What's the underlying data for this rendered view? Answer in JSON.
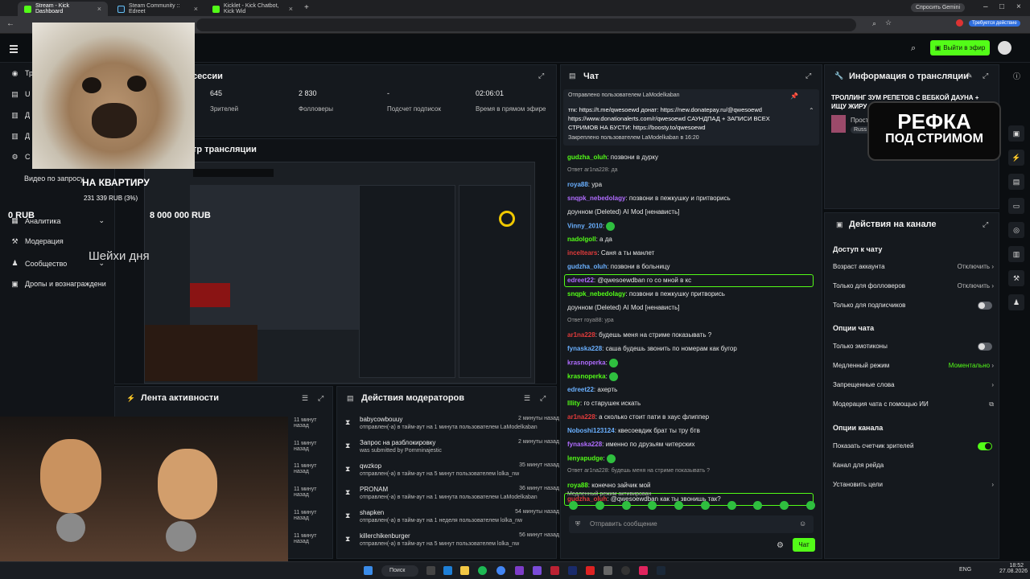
{
  "browser": {
    "tabs": [
      "Stream - Kick Dashboard",
      "Steam Community :: Edreet",
      "Kicklet - Kick Chatbot, Kick Wid"
    ],
    "gemini_label": "Спросить Gemini",
    "action_required": "Требуется действие"
  },
  "header": {
    "go_live": "Выйти в эфир"
  },
  "sidebar": {
    "items": [
      "Тр",
      "U",
      "Д",
      "Д",
      "С",
      "Аналитика",
      "Модерация",
      "Сообщество",
      "Дропы и вознаграждени"
    ],
    "video_label": "Видео по запросу"
  },
  "overlay": {
    "goal_title": "НА КВАРТИРУ",
    "goal_progress": "231 339 RUB (3%)",
    "goal_current": "0 RUB",
    "goal_target": "8 000 000 RUB",
    "pug_caption": "Шейхи дня",
    "refka_line1": "РЕФКА",
    "refka_line2": "ПОД СТРИМОМ"
  },
  "session": {
    "title": "сессии",
    "stats": [
      {
        "value": "645",
        "label": "Зрителей"
      },
      {
        "value": "2 830",
        "label": "Фолловеры"
      },
      {
        "value": "-",
        "label": "Подсчет подписок"
      },
      {
        "value": "02:06:01",
        "label": "Время в прямом эфире"
      }
    ]
  },
  "preview": {
    "title": "тр трансляции"
  },
  "activity": {
    "title": "Лента активности",
    "times": [
      "11 минут назад",
      "11 минут назад",
      "11 минут назад",
      "11 минут назад",
      "11 минут назад",
      "11 минут назад"
    ]
  },
  "modlog": {
    "title": "Действия модераторов",
    "rows": [
      {
        "name": "babycowbouuy",
        "desc": "отправлен(-а) в тайм-аут на 1 минута пользователем LaModelkaban",
        "time": "2 минуты назад"
      },
      {
        "name": "Запрос на разблокировку",
        "desc": "was submitted by Pornminajestic",
        "time": "2 минуты назад"
      },
      {
        "name": "qwzkop",
        "desc": "отправлен(-а) в тайм-аут на 5 минут пользователем lolka_nw",
        "time": "35 минут назад"
      },
      {
        "name": "PRONAM",
        "desc": "отправлен(-а) в тайм-аут на 1 минута пользователем LaModelkaban",
        "time": "36 минут назад"
      },
      {
        "name": "shapken",
        "desc": "отправлен(-а) в тайм-аут на 1 неделя пользователем lolka_nw",
        "time": "54 минуты назад"
      },
      {
        "name": "killerchikenburger",
        "desc": "отправлен(-а) в тайм-аут на 5 минут пользователем lolka_nw",
        "time": "56 минут назад"
      }
    ]
  },
  "chat": {
    "title": "Чат",
    "pinned_by": "Отправлено пользователем LaModelkaban",
    "pinned_lines": [
      "тгк: https://t.me/qwesoewd донат: https://new.donatepay.ru/@qwesoewd",
      "https://www.donationalerts.com/r/qwesoewd САУНДПАД + ЗАПИСИ ВСЕХ",
      "СТРИМОВ НА БУСТИ: https://boosty.to/qwesoewd"
    ],
    "pinned_footer": "Закреплено пользователем LaModelkaban в 16:20",
    "messages": [
      {
        "user": "gudzha_oluh",
        "text": "позвони в дурку"
      },
      {
        "reply": "Ответ ar1na228: да"
      },
      {
        "user": "roya88",
        "text": "ура"
      },
      {
        "user": "snqpk_nebedolagy",
        "text": "позвони в пежкушку и притворись"
      },
      {
        "user": "",
        "text": "доунном (Deleted) AI Mod [ненависть]"
      },
      {
        "user": "Vinny_2010",
        "text": ""
      },
      {
        "user": "nadolgoll",
        "text": "а да"
      },
      {
        "user": "inceltears",
        "text": "Саня а ты манлет"
      },
      {
        "user": "gudzha_oluh",
        "text": "позвони в больницу"
      },
      {
        "user": "edreet22",
        "text": "@qwesoewdban го со мной в кс"
      },
      {
        "user": "snqpk_nebedolagy",
        "text": "позвони в пежкушку притворись"
      },
      {
        "user": "",
        "text": "доунном (Deleted) AI Mod [ненависть]"
      },
      {
        "reply": "Ответ roya88: ура"
      },
      {
        "user": "ar1na228",
        "text": "будешь меня на стриме показывать ?"
      },
      {
        "user": "fynaska228",
        "text": "саша будешь звонить по номерам как бугор"
      },
      {
        "user": "krasnoperka",
        "text": ""
      },
      {
        "user": "krasnoperka",
        "text": ""
      },
      {
        "user": "edreet22",
        "text": "ахерть"
      },
      {
        "user": "lllity",
        "text": "го старушек искать"
      },
      {
        "user": "ar1na228",
        "text": "а сколько стоит пати в хаус флиппер"
      },
      {
        "user": "Noboshi123124",
        "text": "квесоевдик брат ты тру бтв"
      },
      {
        "user": "fynaska228",
        "text": "именно по друзьям читерских"
      },
      {
        "user": "lenyapudge",
        "text": ""
      },
      {
        "reply": "Ответ ar1na228: будешь меня на стриме показывать ?"
      },
      {
        "user": "roya88",
        "text": "конечно зайчик мой"
      },
      {
        "user": "gudzha_oluh",
        "text": "@qwesoewdban как ты звонишь так?"
      }
    ],
    "slow_mode": "Медленный режим активирован",
    "input_placeholder": "Отправить сообщение",
    "send_label": "Чат"
  },
  "stream_info": {
    "title": "Информация о трансляции",
    "line1": "ТРОЛЛИНГ ЗУМ РЕПЕТОВ С ВЕБКОЙ ДАУНА +",
    "line2": "ИЩУ ЖИРУ",
    "tag1": "Прост",
    "tag2": "Russ"
  },
  "channel": {
    "title": "Действия на канале",
    "access_title": "Доступ к чату",
    "rows": [
      {
        "label": "Возраст аккаунта",
        "value": "Отключить"
      },
      {
        "label": "Только для фолловеров",
        "value": "Отключить"
      },
      {
        "label": "Только для подписчиков",
        "value": ""
      }
    ],
    "chat_options_title": "Опции чата",
    "chat_rows": [
      {
        "label": "Только эмотиконы",
        "value": ""
      },
      {
        "label": "Медленный режим",
        "value": "Моментально"
      },
      {
        "label": "Запрещенные слова",
        "value": ""
      },
      {
        "label": "Модерация чата с помощью ИИ",
        "value": ""
      }
    ],
    "channel_options_title": "Опции канала",
    "channel_rows": [
      {
        "label": "Показать счетчик зрителей",
        "value": ""
      },
      {
        "label": "Канал для рейда",
        "value": ""
      },
      {
        "label": "Установить цели",
        "value": ""
      }
    ]
  },
  "taskbar": {
    "search": "Поиск",
    "lang": "ENG",
    "time": "18:52",
    "date": "27.08.2026"
  }
}
